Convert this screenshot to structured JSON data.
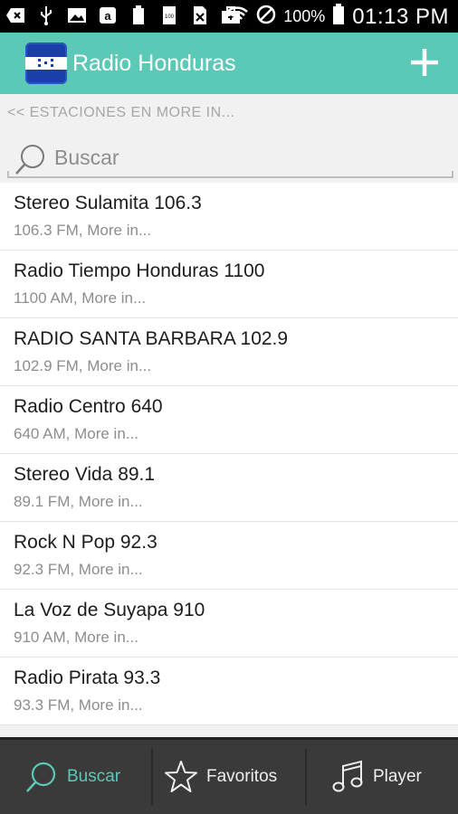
{
  "status_bar": {
    "battery_pct": "100%",
    "time": "01:13 PM"
  },
  "app_bar": {
    "title": "Radio Honduras",
    "add_icon": "plus-icon"
  },
  "breadcrumb": "<< ESTACIONES EN MORE IN...",
  "search": {
    "placeholder": "Buscar",
    "value": ""
  },
  "stations": [
    {
      "name": "Stereo Sulamita 106.3",
      "sub": "106.3 FM, More in..."
    },
    {
      "name": "Radio Tiempo Honduras 1100",
      "sub": "1100 AM, More in..."
    },
    {
      "name": "RADIO SANTA BARBARA 102.9",
      "sub": "102.9 FM, More in..."
    },
    {
      "name": "Radio Centro 640",
      "sub": "640 AM, More in..."
    },
    {
      "name": "Stereo Vida 89.1",
      "sub": "89.1 FM, More in..."
    },
    {
      "name": "Rock N Pop 92.3",
      "sub": "92.3 FM, More in..."
    },
    {
      "name": "La Voz de Suyapa 910",
      "sub": "910 AM, More in..."
    },
    {
      "name": "Radio Pirata 93.3",
      "sub": "93.3 FM, More in..."
    }
  ],
  "bottom_nav": {
    "buscar": "Buscar",
    "favoritos": "Favoritos",
    "player": "Player"
  },
  "colors": {
    "accent": "#5cc9b7",
    "nav_bg": "#3a3a3a"
  }
}
